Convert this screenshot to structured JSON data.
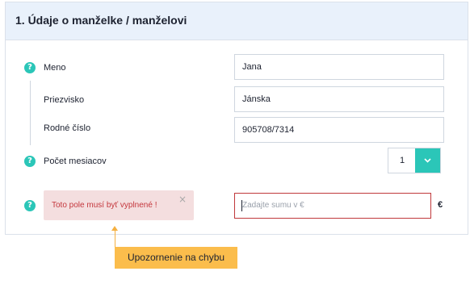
{
  "panel": {
    "title": "1. Údaje o manželke / manželovi"
  },
  "fields": {
    "meno": {
      "label": "Meno",
      "value": "Jana"
    },
    "priezvisko": {
      "label": "Priezvisko",
      "value": "Jánska"
    },
    "rodne_cislo": {
      "label": "Rodné číslo",
      "value": "905708/7314"
    }
  },
  "pocet_mesiacov": {
    "label": "Počet mesiacov",
    "selected": "1"
  },
  "amount": {
    "placeholder": "Zadajte sumu v €",
    "currency": "€"
  },
  "error": {
    "message": "Toto pole musí byť vyplnené !",
    "close": "×"
  },
  "help": {
    "glyph": "?"
  },
  "callout": {
    "text": "Upozornenie na chybu"
  },
  "colors": {
    "accent": "#2bc6b8",
    "error": "#c4373d",
    "callout": "#fbbd4c",
    "header_bg": "#e9f1fb"
  },
  "icons": [
    "help-icon",
    "chevron-down-icon",
    "close-icon"
  ]
}
